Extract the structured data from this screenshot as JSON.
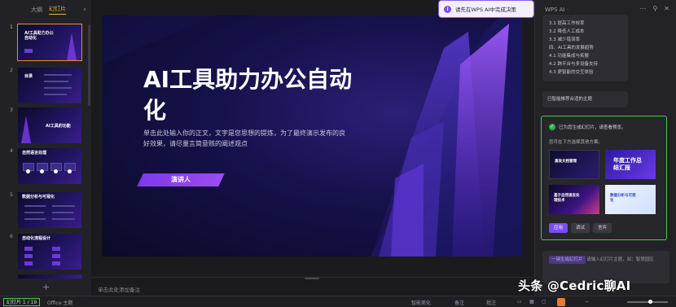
{
  "left_panel": {
    "tabs": [
      {
        "label": "大纲"
      },
      {
        "label": "幻灯片"
      }
    ],
    "thumbnails": [
      {
        "number": "1",
        "title": "AI工具助力办公自动化"
      },
      {
        "number": "2",
        "title": "目录"
      },
      {
        "number": "3",
        "title": "AI工具的功能"
      },
      {
        "number": "4",
        "title": "自然语言处理"
      },
      {
        "number": "5",
        "title": "数据分析与可视化"
      },
      {
        "number": "6",
        "title": "自动化流程设计"
      }
    ]
  },
  "slide": {
    "title": "AI工具助力办公自动化",
    "body": "单击此处输入你的正文，文字是您思想的提炼，为了最终演示发布的良好效果，请尽量言简意赅的阐述观点",
    "presenter": "演讲人"
  },
  "notes_placeholder": "单击此处添加备注",
  "toast": {
    "text": "请先在WPS AI中完成决策"
  },
  "ai_panel": {
    "header": "WPS AI ·",
    "outline_items": [
      "3.1 提高工作效率",
      "3.2 降低人工成本",
      "3.3 减少错误率",
      "四、AI工具的发展趋势",
      "4.1 功能集成与拓展",
      "4.2 跨平台与多设备支持",
      "4.3 更智能的交互体验"
    ],
    "message": "已智能推荐合适的主题",
    "result": {
      "status": "已为您生成幻灯片，请查看预览。",
      "hint": "您可在下方选择其他方案。",
      "templates": [
        {
          "title": "高效文档管理"
        },
        {
          "title": "年度工作总结汇报"
        },
        {
          "title": "基于自然语言处理技术"
        },
        {
          "title": "数据分析与可视化"
        }
      ],
      "buttons": [
        "应用",
        "调试",
        "舍弃"
      ]
    },
    "input": {
      "chip": "一键生成幻灯片",
      "placeholder": "请输入幻灯片主题，如：智慧园区"
    }
  },
  "status_bar": {
    "slide_count": "幻灯片 1 / 19",
    "theme": "Office 主题",
    "smart_beautify": "智能美化",
    "notes": "备注",
    "comments": "批注"
  },
  "watermark": "头条 @Cedric聊AI"
}
